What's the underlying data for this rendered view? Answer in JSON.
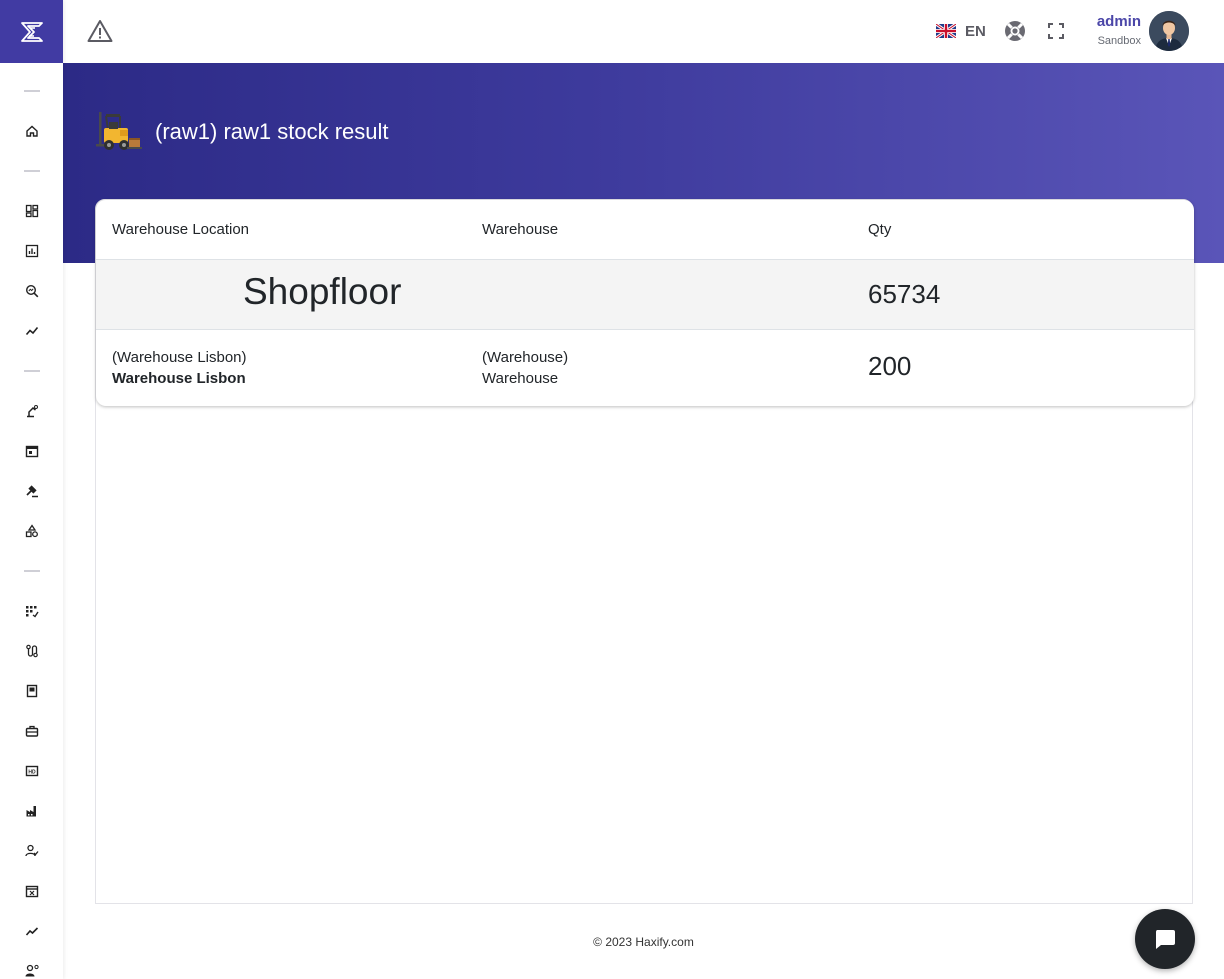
{
  "header": {
    "language_code": "EN",
    "user_name": "admin",
    "user_tenant": "Sandbox"
  },
  "page": {
    "title": "(raw1) raw1 stock result"
  },
  "table": {
    "columns": [
      "Warehouse Location",
      "Warehouse",
      "Qty"
    ],
    "group": {
      "name": "Shopfloor",
      "qty": "65734"
    },
    "rows": [
      {
        "location_code": "(Warehouse Lisbon)",
        "location_name": "Warehouse Lisbon",
        "warehouse_code": "(Warehouse)",
        "warehouse_name": "Warehouse",
        "qty": "200"
      }
    ]
  },
  "footer": {
    "copyright": "© 2023 Haxify.com"
  },
  "sidebar": {
    "items": [
      {
        "type": "separator"
      },
      {
        "type": "icon",
        "icon": "home-icon"
      },
      {
        "type": "separator"
      },
      {
        "type": "icon",
        "icon": "dashboard-icon"
      },
      {
        "type": "icon",
        "icon": "bar-chart-icon"
      },
      {
        "type": "icon",
        "icon": "search-analytics-icon"
      },
      {
        "type": "icon",
        "icon": "line-chart-icon"
      },
      {
        "type": "separator"
      },
      {
        "type": "icon",
        "icon": "robot-arm-icon"
      },
      {
        "type": "icon",
        "icon": "calendar-icon"
      },
      {
        "type": "icon",
        "icon": "gavel-icon"
      },
      {
        "type": "icon",
        "icon": "shapes-icon"
      },
      {
        "type": "separator"
      },
      {
        "type": "icon",
        "icon": "grid-check-icon"
      },
      {
        "type": "icon",
        "icon": "route-icon"
      },
      {
        "type": "icon",
        "icon": "document-icon"
      },
      {
        "type": "icon",
        "icon": "toolbox-icon"
      },
      {
        "type": "icon",
        "icon": "hd-icon"
      },
      {
        "type": "icon",
        "icon": "factory-icon"
      },
      {
        "type": "icon",
        "icon": "user-check-icon"
      },
      {
        "type": "icon",
        "icon": "calendar-x-icon"
      },
      {
        "type": "icon",
        "icon": "trend-icon"
      },
      {
        "type": "icon",
        "icon": "user-settings-icon"
      }
    ]
  },
  "colors": {
    "brand": "#413ba3",
    "banner_start": "#2c2a86",
    "banner_end": "#5a55b8",
    "user_name": "#4b46a8"
  }
}
